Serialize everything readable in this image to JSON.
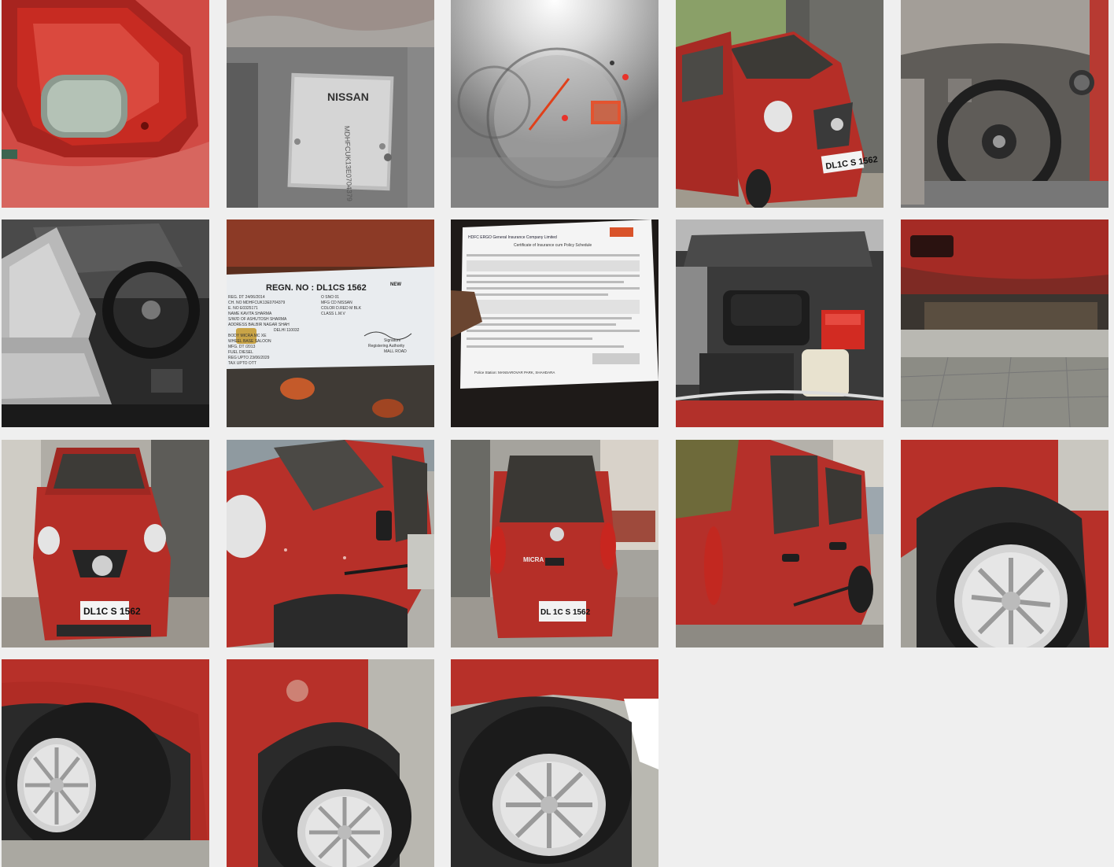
{
  "gallery": {
    "photos": [
      {
        "name": "tail-light-closeup"
      },
      {
        "name": "vin-plate",
        "brand_text": "NISSAN",
        "vin_text": "MDHFCUK13E0704379"
      },
      {
        "name": "instrument-cluster"
      },
      {
        "name": "front-three-quarter-door-open",
        "plate": "DL1C S 1562"
      },
      {
        "name": "dashboard-steering"
      },
      {
        "name": "interior-seats"
      },
      {
        "name": "registration-card",
        "regn_title": "REGN. NO : DL1CS 1562",
        "new_label": "NEW",
        "fields": [
          "REG. DT   24/06/2014",
          "CH. NO   MDHFCUK13E0704379",
          "E. NO   E0325171",
          "NAME   KAVITA SHARMA",
          "S/W/D OF   ASHUTOSH SHARMA",
          "ADDRESS   BALBIR NAGAR SHAH",
          "DELHI   110032",
          "BODY   MICRA MC XE",
          "WHEEL BASE   SALOON",
          "MFG. DT   /2013",
          "FUEL   DIESEL",
          "REG UPTO   23/06/2029",
          "TAX UPTO   OTT"
        ],
        "right_fields": [
          "O SNO   01",
          "MFG CD   NISSAN",
          "COLOR   D.RED M BLK",
          "CLASS   L.M.V"
        ],
        "signature_label": "Signature",
        "authority_label": "Registering Authority",
        "authority_place": "MALL ROAD"
      },
      {
        "name": "insurance-certificate",
        "header_text": "HDFC ERGO General Insurance Company Limited",
        "subtitle": "Certificate of Insurance cum Policy Schedule",
        "footer_text": "Police Station: MANSAROVAR PARK, SHAHDARA"
      },
      {
        "name": "engine-bay"
      },
      {
        "name": "underbody-sill"
      },
      {
        "name": "front-view",
        "plate": "DL1C S 1562"
      },
      {
        "name": "front-left-side"
      },
      {
        "name": "rear-view",
        "plate": "DL 1C S 1562",
        "model_badge": "MICRA"
      },
      {
        "name": "left-side-doors"
      },
      {
        "name": "wheel-rear-left"
      },
      {
        "name": "wheel-front-right"
      },
      {
        "name": "wheel-rear-right"
      },
      {
        "name": "wheel-front-left"
      }
    ]
  },
  "colors": {
    "background": "#efefef",
    "car_red": "#b4322c",
    "car_red_dark": "#7e1e1a",
    "asphalt": "#8f8f8a"
  }
}
